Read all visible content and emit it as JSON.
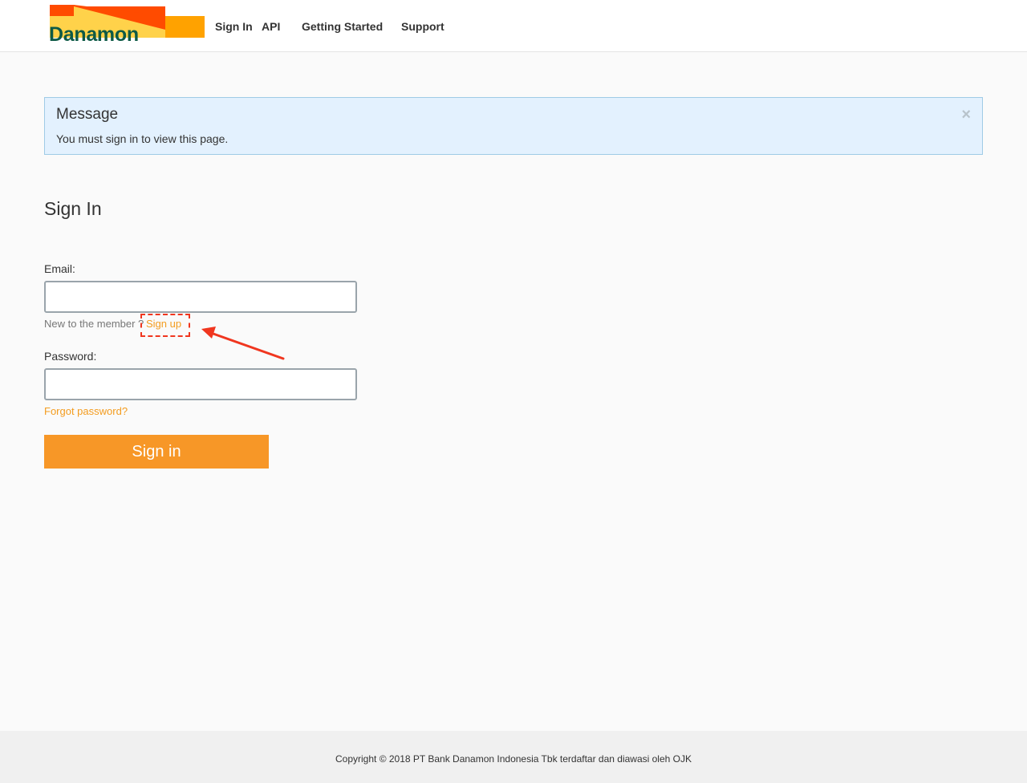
{
  "brand": {
    "name": "Danamon",
    "colors": {
      "green": "#0e5a46",
      "orange_red": "#ff4b00",
      "orange": "#ffa200",
      "yellow": "#ffd24a"
    }
  },
  "nav": {
    "items": [
      {
        "label": "Sign In"
      },
      {
        "label": "API"
      },
      {
        "label": "Getting Started"
      },
      {
        "label": "Support"
      }
    ]
  },
  "alert": {
    "title": "Message",
    "body": "You must sign in to view this page.",
    "close_icon": "close-icon",
    "close_glyph": "×",
    "background": "#e3f1fe",
    "border": "#9fcbe6"
  },
  "signin": {
    "title": "Sign In",
    "email_label": "Email:",
    "email_value": "",
    "helper_text": "New to the member ?",
    "signup_link": "Sign up",
    "password_label": "Password:",
    "password_value": "",
    "forgot_link": "Forgot password?",
    "submit_label": "Sign in",
    "accent_color": "#f79727"
  },
  "annotation": {
    "color": "#f0361f",
    "target": "Sign up"
  },
  "footer": {
    "text": "Copyright © 2018 PT Bank Danamon Indonesia Tbk terdaftar dan diawasi oleh OJK"
  }
}
